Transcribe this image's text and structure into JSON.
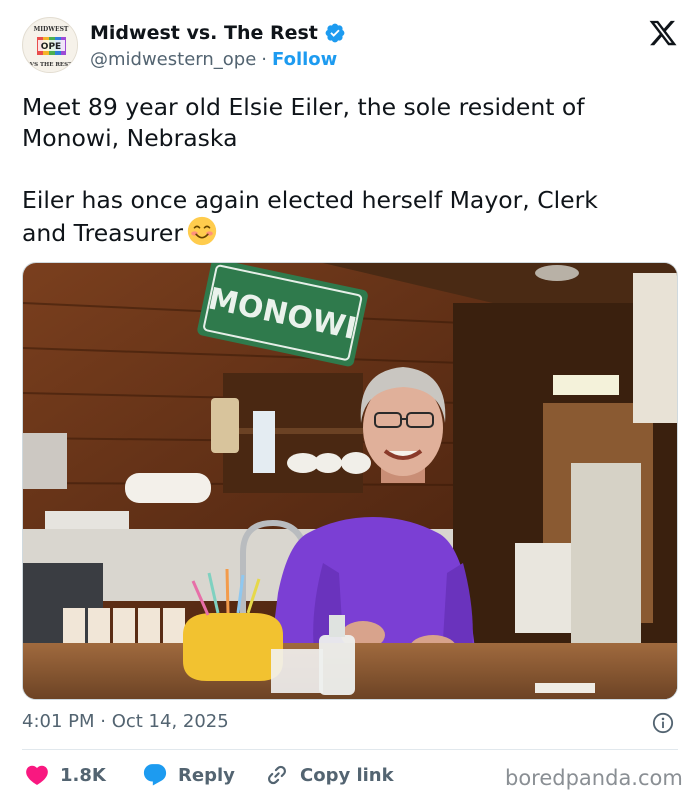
{
  "author": {
    "avatar_alt": "Midwest vs. The Rest logo",
    "avatar_text_top": "MIDWEST",
    "avatar_text_center": "OPE",
    "avatar_text_bottom": "VS THE REST",
    "display_name": "Midwest vs. The Rest",
    "verified": true,
    "handle": "@midwestern_ope",
    "separator": "·",
    "follow_label": "Follow"
  },
  "tweet": {
    "paragraph_1_line_1": "Meet 89 year old Elsie Eiler, the sole resident of",
    "paragraph_1_line_2": "Monowi, Nebraska",
    "paragraph_2_line_1": "Eiler has once again elected herself  Mayor, Clerk",
    "paragraph_2_line_2": "and Treasurer",
    "emoji": "smiling-face-with-smiling-eyes",
    "timestamp": "4:01 PM · Oct 14, 2025"
  },
  "media": {
    "sign_text": "MONOWI"
  },
  "actions": {
    "like_count": "1.8K",
    "reply_label": "Reply",
    "copy_link_label": "Copy link"
  },
  "watermark": "boredpanda.com",
  "colors": {
    "accent": "#1d9bf0",
    "like": "#f91880",
    "text_primary": "#0f1419",
    "text_secondary": "#536471"
  }
}
